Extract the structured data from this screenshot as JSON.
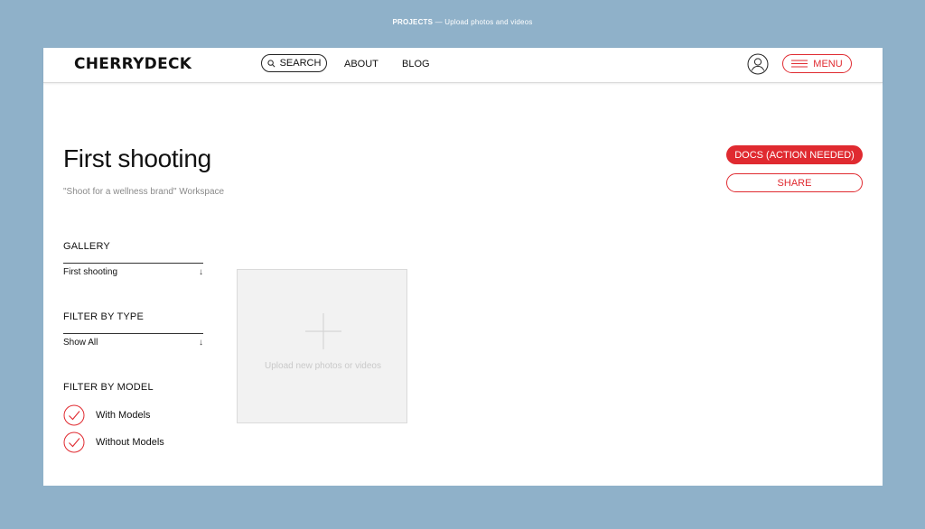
{
  "caption": {
    "section": "PROJECTS",
    "separator": " — ",
    "text": "Upload photos and videos"
  },
  "header": {
    "logo": "CHERRYDECK",
    "search_label": "SEARCH",
    "nav": [
      "ABOUT",
      "BLOG"
    ],
    "menu_label": "MENU"
  },
  "project": {
    "title": "First shooting",
    "workspace": "\"Shoot for a wellness brand\" Workspace",
    "docs_label": "DOCS (ACTION NEEDED)",
    "share_label": "SHARE"
  },
  "sidebar": {
    "gallery": {
      "label": "GALLERY",
      "value": "First shooting"
    },
    "filter_type": {
      "label": "FILTER BY TYPE",
      "value": "Show All"
    },
    "filter_model": {
      "label": "FILTER BY MODEL",
      "options": [
        "With Models",
        "Without Models"
      ]
    }
  },
  "upload": {
    "text": "Upload new photos or videos"
  },
  "colors": {
    "accent": "#e02a30",
    "background": "#8fb1c9",
    "tile": "#f2f2f2"
  },
  "icons": [
    "search-icon",
    "user-icon",
    "hamburger-icon",
    "arrow-down-icon",
    "check-icon",
    "plus-icon"
  ]
}
